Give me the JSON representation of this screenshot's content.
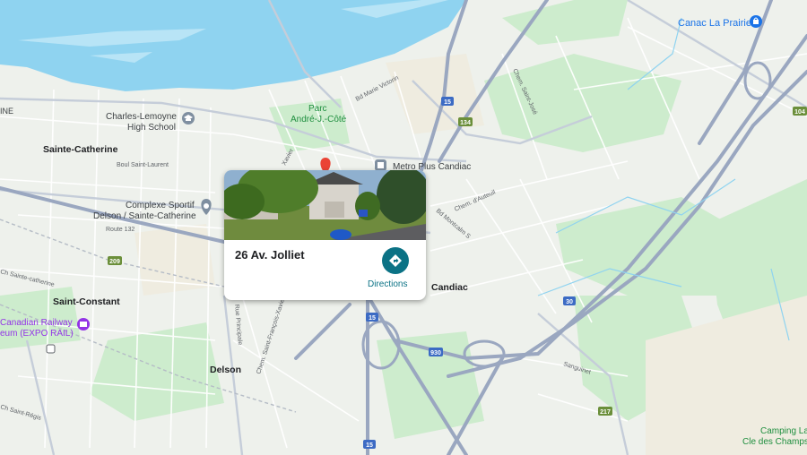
{
  "map": {
    "labels": {
      "canac": "Canac La Prairie",
      "charles_lemoyne_1": "Charles-Lemoyne",
      "charles_lemoyne_2": "High School",
      "parc_1": "Parc",
      "parc_2": "André-J.-Côté",
      "sainte_catherine": "Sainte-Catherine",
      "bould_st_laurent": "Boul Saint-Laurent",
      "metro_plus": "Metro Plus Candiac",
      "complexe_1": "Complexe Sportif",
      "complexe_2": "Delson / Sainte-Catherine",
      "ch_st_catherine": "Ch Sainte-catherine",
      "saint_constant": "Saint-Constant",
      "candiac": "Candiac",
      "railway_1": "Canadian Railway",
      "railway_2": "eum (EXPO RAIL)",
      "delson": "Delson",
      "camping_1": "Camping La",
      "camping_2": "Cle des Champs",
      "ine": "INE",
      "bd_marie_victorin": "Bd Marie Victorin",
      "ch_saint_jose": "Chem. Saint-José",
      "chem_auteuil": "Chem. d'Auteuil",
      "bd_montcalm": "Bd Montcalm S",
      "sanguinet": "Sanguinet",
      "rue_principale": "Rue Principale",
      "ch_st_francois": "Chem. Saint-François-Xavier",
      "ch_st_regis": "Ch Saint-Régis",
      "route_132": "Route 132",
      "xavier": "Xavier"
    },
    "shields": {
      "a15_top": "15",
      "r134": "134",
      "a104": "104",
      "a209": "209",
      "a15_mid": "15",
      "a30": "30",
      "a930": "930",
      "a217": "217",
      "a15_bot": "15"
    },
    "icons": [
      "school-icon",
      "store-icon",
      "shopping-bag-icon",
      "sports-icon",
      "museum-icon",
      "place-marker-icon",
      "train-icon"
    ]
  },
  "popup": {
    "address": "26 Av. Jolliet",
    "directions_label": "Directions"
  },
  "colors": {
    "water": "#8fd3f0",
    "highway": "#9aa7c0",
    "park": "#c9ebc5",
    "directions": "#0b7285",
    "marker": "#ea4335"
  }
}
